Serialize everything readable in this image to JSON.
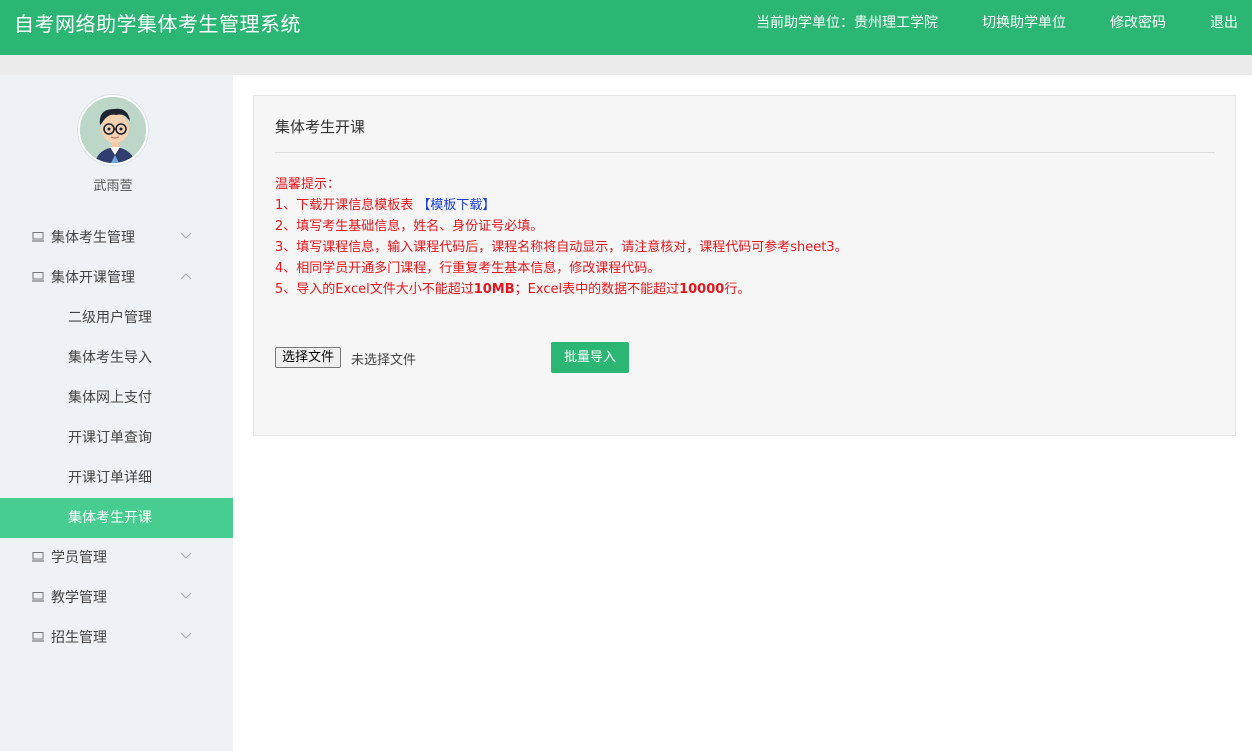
{
  "header": {
    "title": "自考网络助学集体考生管理系统",
    "unit_label": "当前助学单位：",
    "unit_value": "贵州理工学院",
    "switch_unit": "切换助学单位",
    "change_password": "修改密码",
    "logout": "退出"
  },
  "user": {
    "name": "武雨萱"
  },
  "sidebar": {
    "groups": [
      {
        "label": "集体考生管理",
        "expanded": false
      },
      {
        "label": "集体开课管理",
        "expanded": true,
        "items": [
          "二级用户管理",
          "集体考生导入",
          "集体网上支付",
          "开课订单查询",
          "开课订单详细",
          "集体考生开课"
        ],
        "active_index": 5
      },
      {
        "label": "学员管理",
        "expanded": false
      },
      {
        "label": "教学管理",
        "expanded": false
      },
      {
        "label": "招生管理",
        "expanded": false
      }
    ]
  },
  "panel": {
    "title": "集体考生开课",
    "tips": {
      "heading": "温馨提示：",
      "line1_prefix": "1、下载开课信息模板表 ",
      "line1_link": "【模板下载】",
      "line2": "2、填写考生基础信息，姓名、身份证号必填。",
      "line3": "3、填写课程信息，输入课程代码后，课程名称将自动显示，请注意核对，课程代码可参考sheet3。",
      "line4": "4、相同学员开通多门课程，行重复考生基本信息，修改课程代码。",
      "line5_a": "5、导入的Excel文件大小不能超过",
      "line5_b": "10MB",
      "line5_c": "；Excel表中的数据不能超过",
      "line5_d": "10000",
      "line5_e": "行。"
    },
    "file_button": "选择文件",
    "file_status": "未选择文件",
    "import_button": "批量导入"
  },
  "colors": {
    "brand": "#2bb673",
    "active_menu": "#48cd91",
    "tip_text": "#e4161e",
    "link": "#1a3fd6"
  }
}
